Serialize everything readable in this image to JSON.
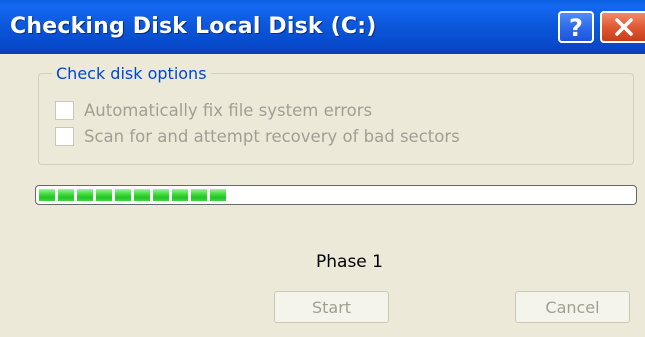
{
  "window": {
    "title": "Checking Disk Local Disk (C:)",
    "help_label": "?",
    "close_icon": "close-icon"
  },
  "options": {
    "legend": "Check disk options",
    "items": [
      {
        "label": "Automatically fix file system errors",
        "checked": false,
        "enabled": false
      },
      {
        "label": "Scan for and attempt recovery of bad sectors",
        "checked": false,
        "enabled": false
      }
    ]
  },
  "progress": {
    "fraction": 0.32
  },
  "status": {
    "phase": "Phase 1"
  },
  "buttons": {
    "start_label": "Start",
    "cancel_label": "Cancel"
  },
  "colors": {
    "titlebar": "#0b56da",
    "dialog_bg": "#ece9d8",
    "legend_text": "#0046d5",
    "disabled_text": "#a19f94",
    "progress_green": "#23c424",
    "close_button": "#e05a34"
  }
}
